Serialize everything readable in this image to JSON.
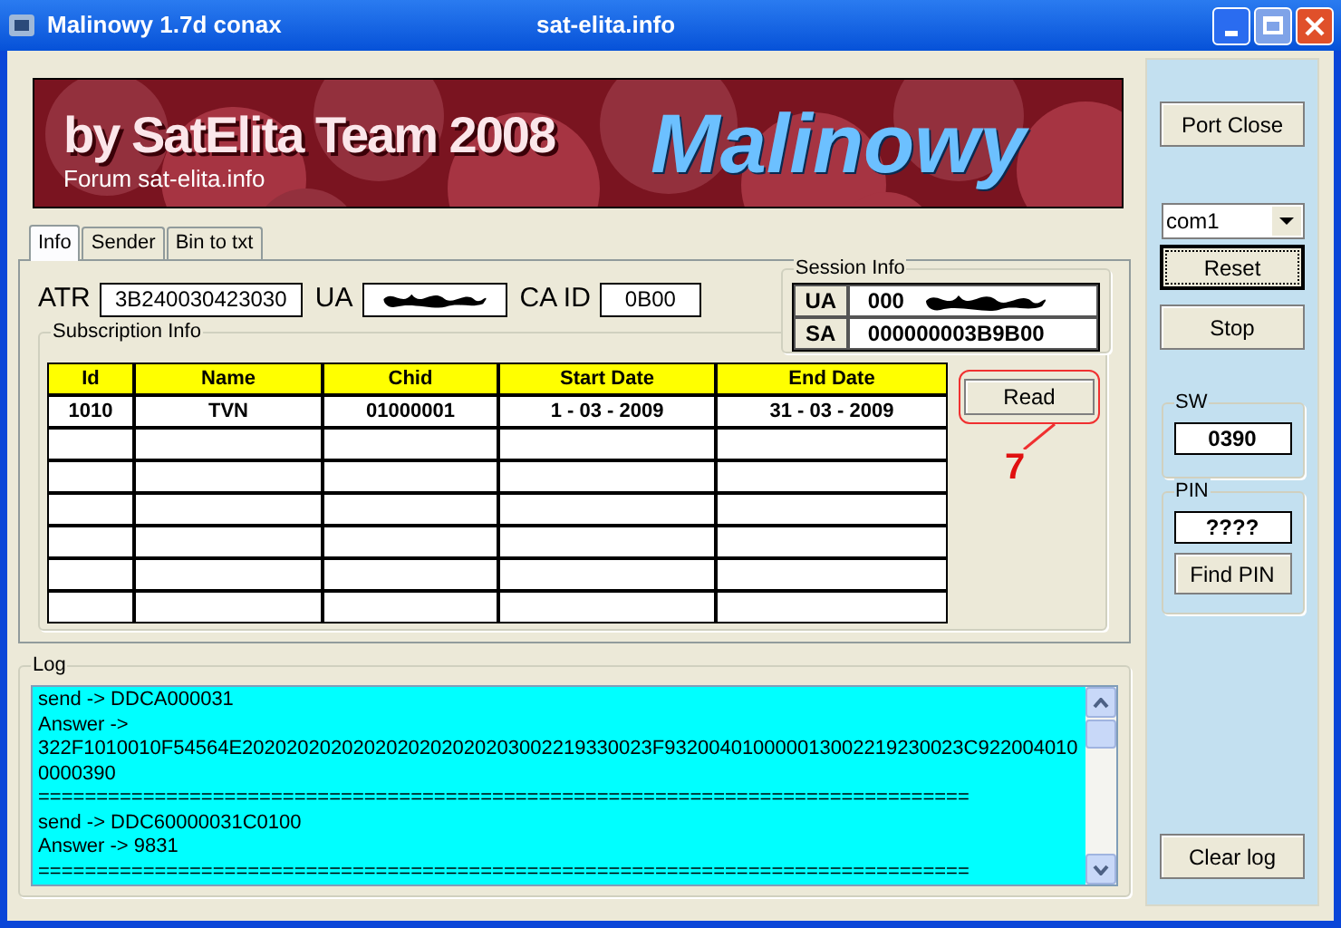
{
  "window": {
    "title": "Malinowy 1.7d conax",
    "subtitle": "sat-elita.info"
  },
  "banner": {
    "headline": "by SatElita Team 2008",
    "forum": "Forum sat-elita.info",
    "logo": "Malinowy"
  },
  "tabs": [
    {
      "label": "Info",
      "selected": true
    },
    {
      "label": "Sender",
      "selected": false
    },
    {
      "label": "Bin to txt",
      "selected": false
    }
  ],
  "card": {
    "atr_label": "ATR",
    "atr": "3B240030423030",
    "ua_label": "UA",
    "ua_redacted": true,
    "caid_label": "CA ID",
    "caid": "0B00"
  },
  "session_info": {
    "title": "Session Info",
    "rows": [
      {
        "label": "UA",
        "value": "000",
        "redacted": true
      },
      {
        "label": "SA",
        "value": "000000003B9B00",
        "redacted": false
      }
    ]
  },
  "subscription": {
    "title": "Subscription Info",
    "columns": [
      "Id",
      "Name",
      "Chid",
      "Start Date",
      "End Date"
    ],
    "rows": [
      [
        "1010",
        "TVN",
        "01000001",
        "1 - 03 - 2009",
        "31 - 03 - 2009"
      ]
    ]
  },
  "read_button": {
    "label": "Read",
    "focused": false
  },
  "annotation": {
    "label": "7"
  },
  "log": {
    "title": "Log",
    "lines": [
      "send -> DDCA000031",
      "Answer ->",
      "322F1010010F54564E2020202020202020202020203002219330023F932004010000013002219230023C9220040100000390",
      "================================================================================",
      "send -> DDC60000031C0100",
      "Answer -> 9831",
      "================================================================================"
    ]
  },
  "side": {
    "port_button": {
      "label": "Port Close",
      "focused": false
    },
    "port": "com1",
    "reset": {
      "label": "Reset",
      "focused": true
    },
    "stop": {
      "label": "Stop",
      "focused": false
    },
    "sw_title": "SW",
    "sw": "0390",
    "pin_title": "PIN",
    "pin": "????",
    "find_pin": {
      "label": "Find PIN",
      "focused": false
    },
    "clear_log": {
      "label": "Clear log",
      "focused": false
    }
  }
}
